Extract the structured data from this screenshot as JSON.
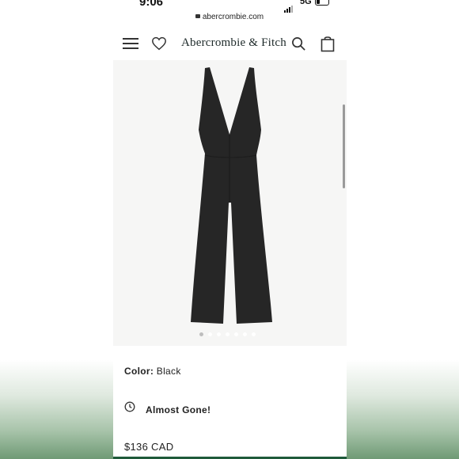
{
  "status_bar": {
    "time": "9:06",
    "network": "5G",
    "url": "abercrombie.com"
  },
  "header": {
    "brand": "Abercrombie & Fitch"
  },
  "gallery": {
    "image_count": 7,
    "current_image": 1,
    "image_alt": "black jumpsuit product photo"
  },
  "product": {
    "color_label": "Color:",
    "color_value": "Black",
    "stock_status": "Almost Gone!",
    "price": "$136 CAD"
  },
  "colors": {
    "accent_green": "#1f5a3a",
    "garment": "#262626"
  }
}
